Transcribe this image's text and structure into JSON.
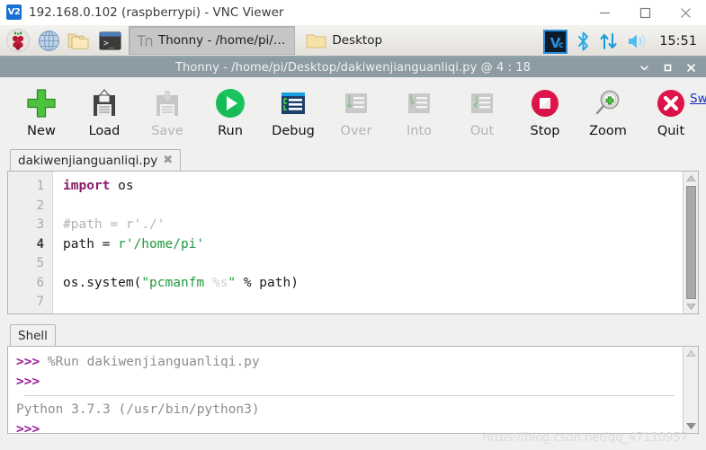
{
  "vnc": {
    "logo_text": "V2",
    "title": "192.168.0.102 (raspberrypi) - VNC Viewer",
    "minimize_label": "Minimize",
    "maximize_label": "Maximize",
    "close_label": "Close"
  },
  "taskbar": {
    "launchers": [
      {
        "name": "raspberry-menu-icon",
        "label": "Menu"
      },
      {
        "name": "web-browser-icon",
        "label": "Web Browser"
      },
      {
        "name": "file-manager-icon",
        "label": "File Manager"
      },
      {
        "name": "terminal-icon",
        "label": "Terminal"
      }
    ],
    "tasks": [
      {
        "name": "task-thonny",
        "label": "Thonny  -  /home/pi/…",
        "active": true
      },
      {
        "name": "task-desktop",
        "label": "Desktop",
        "active": false
      }
    ],
    "tray": [
      {
        "name": "vnc-server-icon",
        "label": "VNC Server"
      },
      {
        "name": "bluetooth-icon",
        "label": "Bluetooth"
      },
      {
        "name": "network-icon",
        "label": "Network"
      },
      {
        "name": "volume-icon",
        "label": "Volume"
      }
    ],
    "clock": "15:51"
  },
  "thonny": {
    "title": "Thonny  -  /home/pi/Desktop/dakiwenjianguanliqi.py  @  4 : 18",
    "minimize_label": "Minimize",
    "maximize_label": "Maximize",
    "close_label": "Close",
    "mode_link": "Switch to regular mode",
    "toolbar": [
      {
        "name": "new-button",
        "label": "New",
        "icon": "plus-icon",
        "disabled": false
      },
      {
        "name": "load-button",
        "label": "Load",
        "icon": "floppy-open-icon",
        "disabled": false
      },
      {
        "name": "save-button",
        "label": "Save",
        "icon": "floppy-save-icon",
        "disabled": true
      },
      {
        "name": "run-button",
        "label": "Run",
        "icon": "play-icon",
        "disabled": false
      },
      {
        "name": "debug-button",
        "label": "Debug",
        "icon": "debug-icon",
        "disabled": false
      },
      {
        "name": "over-button",
        "label": "Over",
        "icon": "step-over-icon",
        "disabled": true
      },
      {
        "name": "into-button",
        "label": "Into",
        "icon": "step-into-icon",
        "disabled": true
      },
      {
        "name": "out-button",
        "label": "Out",
        "icon": "step-out-icon",
        "disabled": true
      },
      {
        "name": "stop-button",
        "label": "Stop",
        "icon": "stop-icon",
        "disabled": false
      },
      {
        "name": "zoom-button",
        "label": "Zoom",
        "icon": "magnifier-plus-icon",
        "disabled": false
      },
      {
        "name": "quit-button",
        "label": "Quit",
        "icon": "close-circle-icon",
        "disabled": false
      }
    ],
    "editor": {
      "tab_label": "dakiwenjianguanliqi.py",
      "tab_close": "✖",
      "cursor_line": 4,
      "line_numbers": [
        "1",
        "2",
        "3",
        "4",
        "5",
        "6",
        "7"
      ],
      "lines": [
        {
          "n": "1",
          "tokens": [
            {
              "t": "import",
              "c": "k-kw"
            },
            {
              "t": " os",
              "c": ""
            }
          ]
        },
        {
          "n": "2",
          "tokens": [
            {
              "t": "",
              "c": ""
            }
          ]
        },
        {
          "n": "3",
          "tokens": [
            {
              "t": "#path = r'./'",
              "c": "k-cmt"
            }
          ]
        },
        {
          "n": "4",
          "tokens": [
            {
              "t": "path = ",
              "c": ""
            },
            {
              "t": "r'/home/pi'",
              "c": "k-str"
            }
          ]
        },
        {
          "n": "5",
          "tokens": [
            {
              "t": "",
              "c": ""
            }
          ]
        },
        {
          "n": "6",
          "tokens": [
            {
              "t": "os.system(",
              "c": ""
            },
            {
              "t": "\"pcmanfm ",
              "c": "k-str"
            },
            {
              "t": "%s",
              "c": "k-pct"
            },
            {
              "t": "\"",
              "c": "k-str"
            },
            {
              "t": " % path)",
              "c": ""
            }
          ]
        },
        {
          "n": "7",
          "tokens": [
            {
              "t": "",
              "c": ""
            }
          ]
        }
      ]
    },
    "shell": {
      "tab_label": "Shell",
      "lines_top": [
        {
          "prompt": ">>>",
          "text": " %Run dakiwenjianguanliqi.py"
        },
        {
          "prompt": ">>>",
          "text": ""
        }
      ],
      "lines_bottom": [
        {
          "prompt": "",
          "text": "Python 3.7.3 (/usr/bin/python3)"
        },
        {
          "prompt": ">>>",
          "text": ""
        }
      ]
    }
  },
  "watermark": "https://blog.csdn.net/qq_47110957",
  "colors": {
    "accent_green": "#23c552",
    "accent_red": "#d81b48",
    "title_bar": "#8d9ba3",
    "link": "#1b2fbf"
  }
}
